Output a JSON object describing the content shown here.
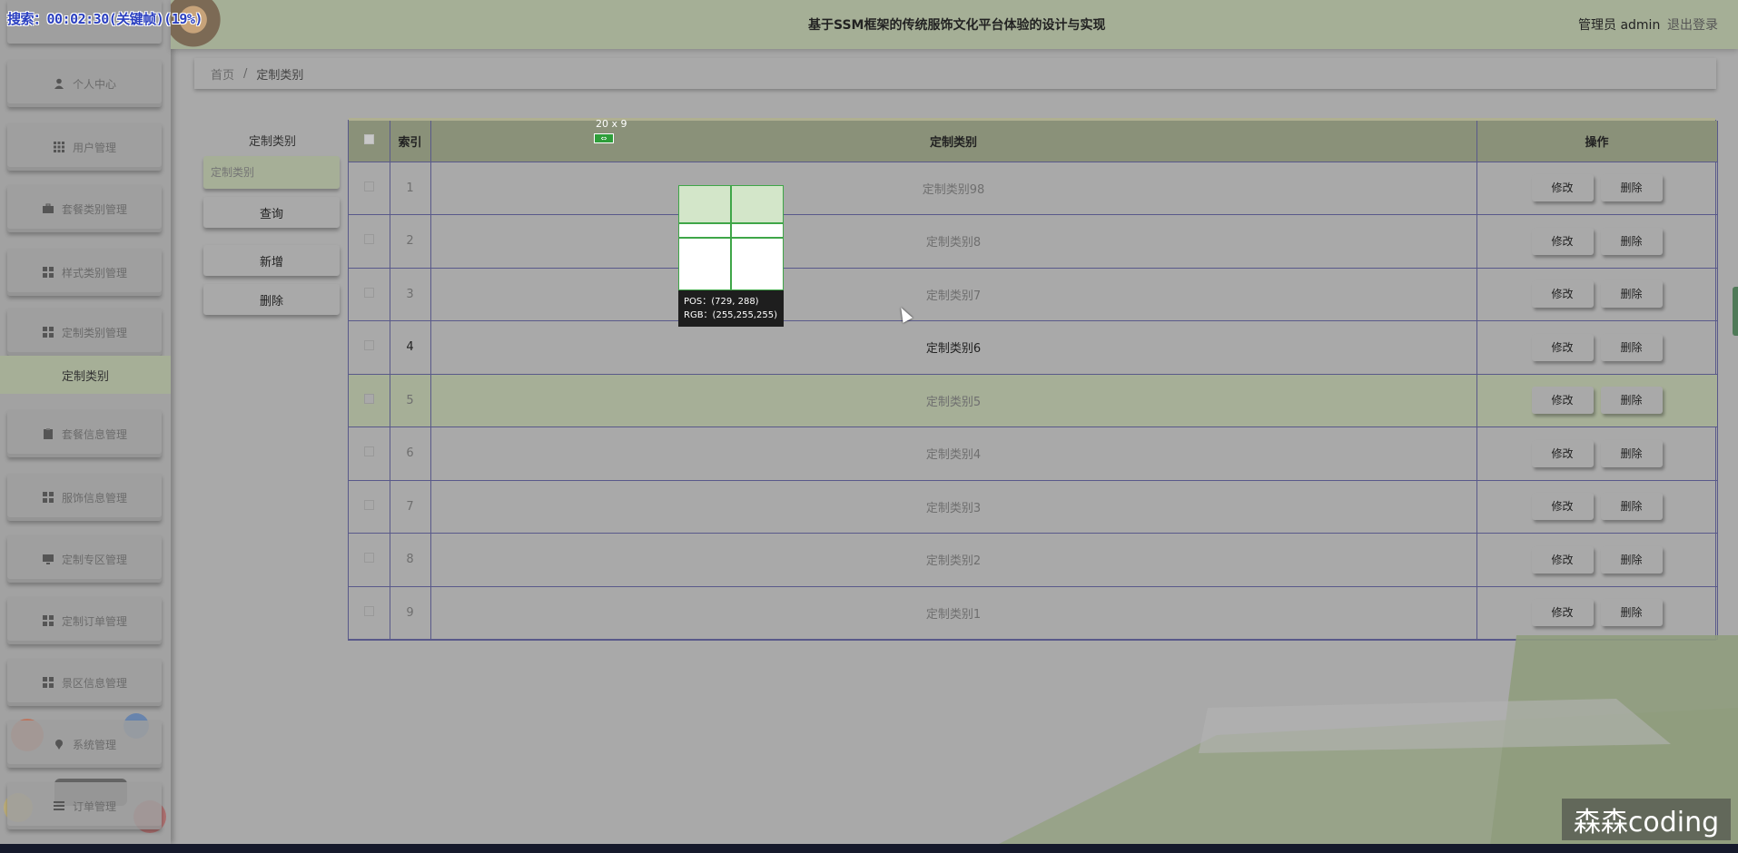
{
  "timer_text": "搜索：00:02:30(关键帧)(19%)",
  "header": {
    "title": "基于SSM框架的传统服饰文化平台体验的设计与实现",
    "user": "管理员 admin",
    "logout": "退出登录"
  },
  "sidebar": {
    "items": [
      {
        "label": "个人中心",
        "icon": "person-icon"
      },
      {
        "label": "用户管理",
        "icon": "grid-icon"
      },
      {
        "label": "套餐类别管理",
        "icon": "briefcase-icon"
      },
      {
        "label": "样式类别管理",
        "icon": "grid-icon"
      },
      {
        "label": "定制类别管理",
        "icon": "grid-icon"
      },
      {
        "label": "套餐信息管理",
        "icon": "clipboard-icon"
      },
      {
        "label": "服饰信息管理",
        "icon": "grid-icon"
      },
      {
        "label": "定制专区管理",
        "icon": "monitor-icon"
      },
      {
        "label": "定制订单管理",
        "icon": "grid-icon"
      },
      {
        "label": "景区信息管理",
        "icon": "grid-icon"
      },
      {
        "label": "系统管理",
        "icon": "pin-icon"
      },
      {
        "label": "订单管理",
        "icon": "list-icon"
      }
    ],
    "active_sub": "定制类别"
  },
  "breadcrumb": {
    "home": "首页",
    "separator": "/",
    "current": "定制类别"
  },
  "search": {
    "label": "定制类别",
    "placeholder": "定制类别",
    "query_button": "查询",
    "add_button": "新增",
    "delete_button": "删除"
  },
  "table": {
    "headers": {
      "index": "索引",
      "category": "定制类别",
      "actions": "操作"
    },
    "edit_label": "修改",
    "delete_label": "删除",
    "rows": [
      {
        "index": "1",
        "category": "定制类别98"
      },
      {
        "index": "2",
        "category": "定制类别8"
      },
      {
        "index": "3",
        "category": "定制类别7"
      },
      {
        "index": "4",
        "category": "定制类别6"
      },
      {
        "index": "5",
        "category": "定制类别5"
      },
      {
        "index": "6",
        "category": "定制类别4"
      },
      {
        "index": "7",
        "category": "定制类别3"
      },
      {
        "index": "8",
        "category": "定制类别2"
      },
      {
        "index": "9",
        "category": "定制类别1"
      }
    ]
  },
  "measure": {
    "size_text": "20 x 9",
    "pos_text": "POS：(729, 288)",
    "rgb_text": "RGB：(255,255,255)"
  },
  "watermark": "森森coding",
  "colors": {
    "accent": "#a5af96",
    "table_header": "#8a9179",
    "background": "#a9a9a9"
  }
}
